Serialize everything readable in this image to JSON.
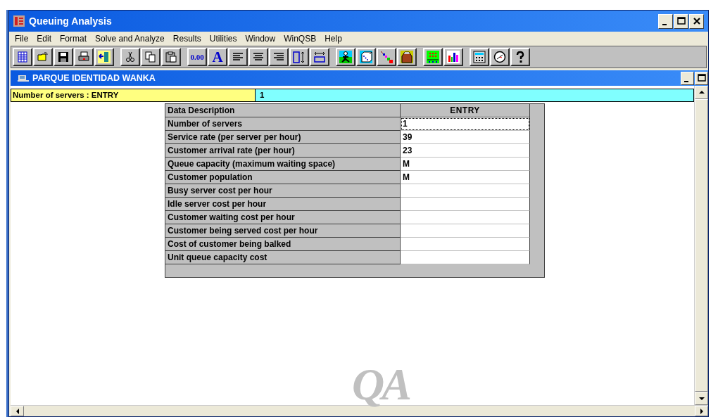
{
  "window": {
    "title": "Queuing Analysis"
  },
  "menu": [
    "File",
    "Edit",
    "Format",
    "Solve and Analyze",
    "Results",
    "Utilities",
    "Window",
    "WinQSB",
    "Help"
  ],
  "toolbar": {
    "number_format_label": "0.00",
    "font_label": "A"
  },
  "child_window": {
    "title": "PARQUE IDENTIDAD WANKA",
    "cell_label": "Number of servers : ENTRY",
    "cell_value": "1"
  },
  "table": {
    "columns": [
      "Data Description",
      "ENTRY"
    ],
    "rows": [
      {
        "description": "Number of servers",
        "entry": "1",
        "selected": true
      },
      {
        "description": "Service rate (per server per hour)",
        "entry": "39",
        "selected": false
      },
      {
        "description": "Customer arrival rate (per hour)",
        "entry": "23",
        "selected": false
      },
      {
        "description": "Queue capacity (maximum waiting space)",
        "entry": "M",
        "selected": false
      },
      {
        "description": "Customer population",
        "entry": "M",
        "selected": false
      },
      {
        "description": "Busy server cost per hour",
        "selected": false
      },
      {
        "description": "Idle server cost per hour",
        "selected": false
      },
      {
        "description": "Customer waiting cost per hour",
        "selected": false
      },
      {
        "description": "Customer being served cost per hour",
        "selected": false
      },
      {
        "description": "Cost of customer being balked",
        "selected": false
      },
      {
        "description": "Unit queue capacity cost",
        "selected": false
      }
    ]
  },
  "logo": "QA"
}
